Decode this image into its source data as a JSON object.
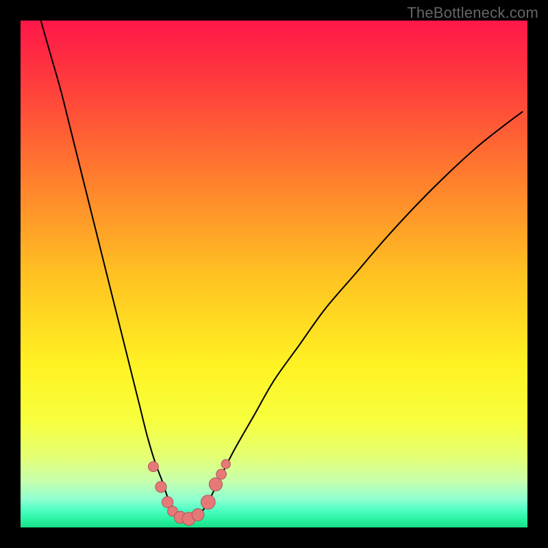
{
  "watermark": "TheBottleneck.com",
  "colors": {
    "black": "#000000",
    "curve": "#000000",
    "marker_fill": "#e77878",
    "marker_stroke": "#a55050"
  },
  "chart_data": {
    "type": "line",
    "title": "",
    "xlabel": "",
    "ylabel": "",
    "xlim": [
      0,
      100
    ],
    "ylim": [
      0,
      100
    ],
    "gradient_stops": [
      {
        "offset": 0.0,
        "color": "#ff1749"
      },
      {
        "offset": 0.12,
        "color": "#ff3b3d"
      },
      {
        "offset": 0.3,
        "color": "#ff7a2e"
      },
      {
        "offset": 0.5,
        "color": "#ffc122"
      },
      {
        "offset": 0.68,
        "color": "#fff223"
      },
      {
        "offset": 0.79,
        "color": "#f7ff3e"
      },
      {
        "offset": 0.86,
        "color": "#e4ff73"
      },
      {
        "offset": 0.91,
        "color": "#c6ffaf"
      },
      {
        "offset": 0.945,
        "color": "#8dffd0"
      },
      {
        "offset": 0.965,
        "color": "#4fffc2"
      },
      {
        "offset": 0.985,
        "color": "#28f2a0"
      },
      {
        "offset": 1.0,
        "color": "#19de87"
      }
    ],
    "series": [
      {
        "name": "bottleneck-curve",
        "x": [
          4,
          6,
          8,
          10,
          12,
          14,
          16,
          18,
          20,
          22,
          23.5,
          25,
          26.5,
          28,
          29,
          30,
          31,
          32,
          33,
          34,
          35.5,
          37,
          39,
          42,
          46,
          50,
          55,
          60,
          66,
          72,
          78,
          84,
          90,
          95,
          99
        ],
        "y": [
          100,
          93,
          86,
          78,
          70,
          62,
          54,
          46,
          38,
          30,
          24,
          18,
          13,
          9,
          6,
          4,
          2.5,
          1.8,
          1.6,
          1.8,
          2.8,
          5,
          9,
          15,
          22,
          29,
          36,
          43,
          50,
          57,
          63.5,
          69.5,
          75,
          79,
          82
        ]
      }
    ],
    "markers": [
      {
        "x": 26.2,
        "y": 12.0,
        "r": 1.0
      },
      {
        "x": 27.7,
        "y": 8.0,
        "r": 1.1
      },
      {
        "x": 29.0,
        "y": 5.0,
        "r": 1.1
      },
      {
        "x": 30.0,
        "y": 3.2,
        "r": 1.0
      },
      {
        "x": 31.5,
        "y": 2.0,
        "r": 1.2
      },
      {
        "x": 33.2,
        "y": 1.7,
        "r": 1.3
      },
      {
        "x": 35.0,
        "y": 2.5,
        "r": 1.2
      },
      {
        "x": 37.0,
        "y": 5.0,
        "r": 1.4
      },
      {
        "x": 38.5,
        "y": 8.5,
        "r": 1.3
      },
      {
        "x": 39.6,
        "y": 10.5,
        "r": 1.0
      },
      {
        "x": 40.5,
        "y": 12.5,
        "r": 0.9
      }
    ]
  }
}
